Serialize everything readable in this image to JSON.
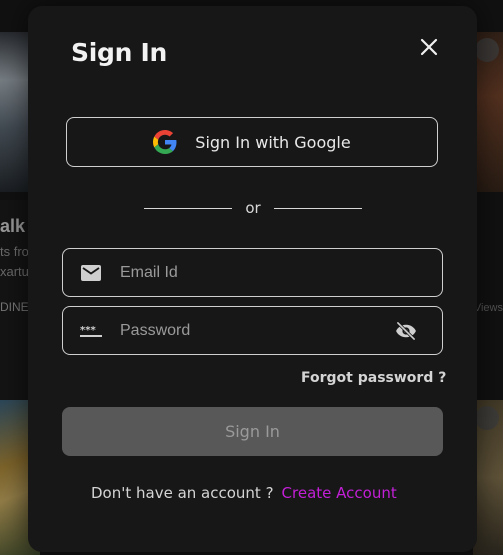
{
  "background": {
    "left_text_1": "alk C",
    "left_text_2": "ts fro",
    "left_text_3": "xartu",
    "left_text_4": "DINE",
    "right_text_views": "Views"
  },
  "modal": {
    "title": "Sign In",
    "google_button_label": "Sign In with Google",
    "divider_text": "or",
    "email": {
      "placeholder": "Email Id",
      "value": ""
    },
    "password": {
      "placeholder": "Password",
      "value": ""
    },
    "forgot_password_label": "Forgot password ?",
    "submit_label": "Sign In",
    "no_account_prompt": "Don't have an account ?",
    "create_account_label": "Create Account"
  },
  "icons": {
    "close": "close-icon",
    "google": "google-icon",
    "email": "mail-icon",
    "password": "password-icon",
    "toggle_visibility": "eye-off-icon"
  },
  "colors": {
    "modal_bg": "#171717",
    "accent_link": "#c21fd6",
    "submit_bg": "#585858"
  }
}
